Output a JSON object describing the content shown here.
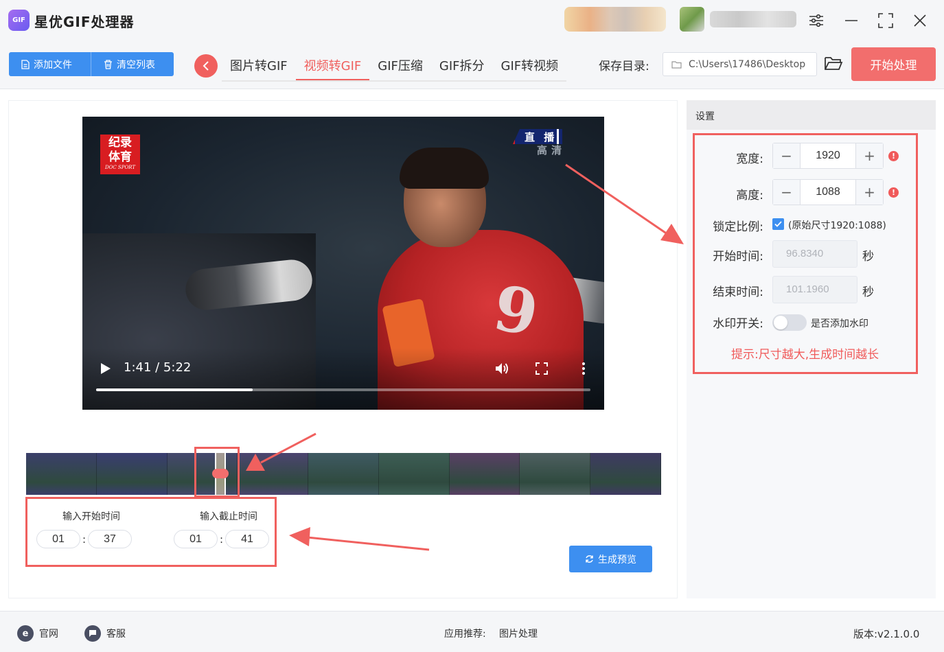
{
  "app": {
    "title": "星优GIF处理器",
    "logo_text": "GIF"
  },
  "toolbar": {
    "add_file": "添加文件",
    "clear_list": "清空列表",
    "tabs": [
      "图片转GIF",
      "视频转GIF",
      "GIF压缩",
      "GIF拆分",
      "GIF转视频"
    ],
    "active_tab": "视频转GIF",
    "save_dir_label": "保存目录:",
    "save_dir_path": "C:\\Users\\17486\\Desktop",
    "start_button": "开始处理"
  },
  "video": {
    "logo_lines": [
      "纪录",
      "体育"
    ],
    "logo_sub": "DOC SPORT",
    "live_badge": "直 播",
    "hd_badge": "高清",
    "jersey_number": "9",
    "time_display": "1:41 / 5:22",
    "progress": 0.316
  },
  "timeline": {
    "frame_count": 9,
    "frame_colors": [
      "#3b3f6b",
      "#3a3d72",
      "#45486e",
      "#4c4470",
      "#3f5a63",
      "#3d5e55",
      "#5a3f65",
      "#4e5f60",
      "#3f3a63"
    ]
  },
  "time_range": {
    "start_label": "输入开始时间",
    "start_min": "01",
    "start_sec": "37",
    "end_label": "输入截止时间",
    "end_min": "01",
    "end_sec": "41",
    "colon": ":"
  },
  "preview_button": "生成预览",
  "settings": {
    "header": "设置",
    "width_label": "宽度:",
    "width_value": "1920",
    "height_label": "高度:",
    "height_value": "1088",
    "lock_label": "锁定比例:",
    "lock_checked": true,
    "lock_text": "(原始尺寸1920:1088)",
    "start_time_label": "开始时间:",
    "start_time_value": "96.8340",
    "end_time_label": "结束时间:",
    "end_time_value": "101.1960",
    "unit": "秒",
    "watermark_label": "水印开关:",
    "watermark_enabled": false,
    "watermark_text": "是否添加水印",
    "hint": "提示:尺寸越大,生成时间越长",
    "warn_icon": "!"
  },
  "footer": {
    "website": "官网",
    "website_icon": "e",
    "service": "客服",
    "recommend_label": "应用推荐:",
    "recommend_app": "图片处理",
    "version": "版本:v2.1.0.0"
  },
  "colors": {
    "accent": "#3d8ff0",
    "danger": "#f0605e",
    "start_btn": "#f26e6d"
  }
}
